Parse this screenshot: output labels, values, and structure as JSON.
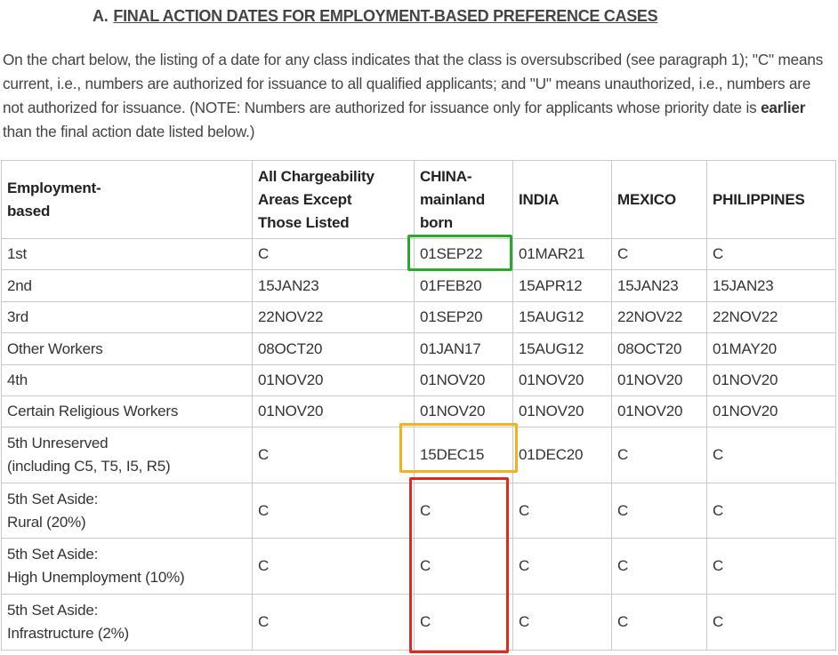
{
  "section": {
    "letter": "A.",
    "title": "FINAL ACTION DATES FOR EMPLOYMENT-BASED PREFERENCE CASES"
  },
  "intro": {
    "part1": "On the chart below, the listing of a date for any class indicates that the class is oversubscribed (see paragraph 1); \"C\" means current, i.e., numbers are authorized for issuance to all qualified applicants; and \"U\" means unauthorized, i.e., numbers are not authorized for issuance. (NOTE: Numbers are authorized for issuance only for applicants whose priority date is ",
    "emphasis": "earlier",
    "part2": " than the final action date listed below.)"
  },
  "table": {
    "headers": [
      "Employment-\nbased",
      "All Chargeability\nAreas Except\nThose Listed",
      "CHINA-\nmainland\nborn",
      "INDIA",
      "MEXICO",
      "PHILIPPINES"
    ],
    "rows": [
      [
        "1st",
        "C",
        "01SEP22",
        "01MAR21",
        "C",
        "C"
      ],
      [
        "2nd",
        "15JAN23",
        "01FEB20",
        "15APR12",
        "15JAN23",
        "15JAN23"
      ],
      [
        "3rd",
        "22NOV22",
        "01SEP20",
        "15AUG12",
        "22NOV22",
        "22NOV22"
      ],
      [
        "Other Workers",
        "08OCT20",
        "01JAN17",
        "15AUG12",
        "08OCT20",
        "01MAY20"
      ],
      [
        "4th",
        "01NOV20",
        "01NOV20",
        "01NOV20",
        "01NOV20",
        "01NOV20"
      ],
      [
        "Certain Religious Workers",
        "01NOV20",
        "01NOV20",
        "01NOV20",
        "01NOV20",
        "01NOV20"
      ],
      [
        "5th Unreserved\n(including C5, T5, I5, R5)",
        "C",
        "15DEC15",
        "01DEC20",
        "C",
        "C"
      ],
      [
        "5th Set Aside:\nRural (20%)",
        "C",
        "C",
        "C",
        "C",
        "C"
      ],
      [
        "5th Set Aside:\nHigh Unemployment (10%)",
        "C",
        "C",
        "C",
        "C",
        "C"
      ],
      [
        "5th Set Aside:\nInfrastructure (2%)",
        "C",
        "C",
        "C",
        "C",
        "C"
      ]
    ]
  },
  "highlights": {
    "green": "#2aa82a",
    "orange": "#f2b21b",
    "red": "#e02a20"
  }
}
